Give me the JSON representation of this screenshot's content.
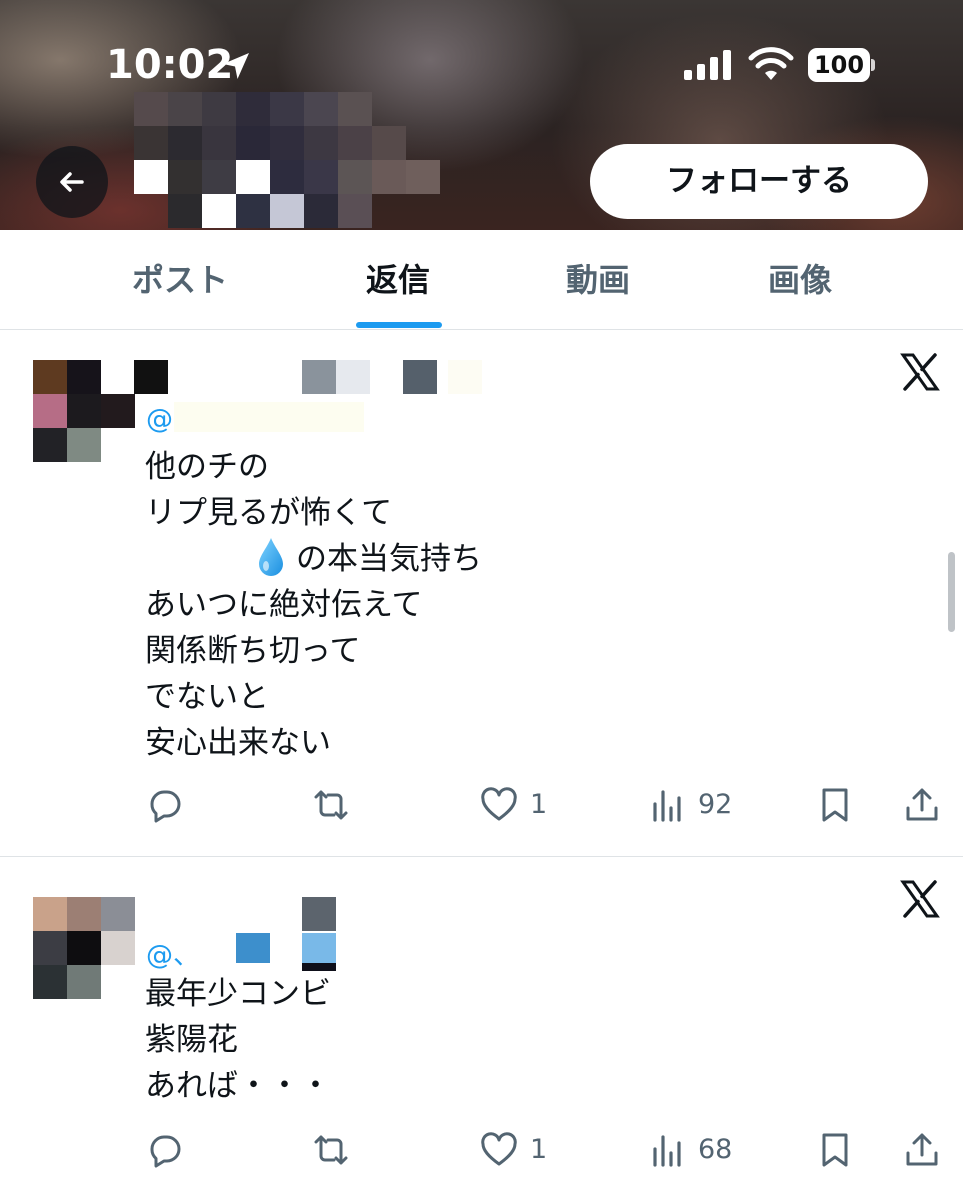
{
  "status_bar": {
    "time": "10:02",
    "battery": "100"
  },
  "header": {
    "follow_label": "フォローする"
  },
  "tabs": [
    {
      "label": "ポスト"
    },
    {
      "label": "返信"
    },
    {
      "label": "動画"
    },
    {
      "label": "画像"
    }
  ],
  "tweets": [
    {
      "handle": "@",
      "lines": [
        "他のチの",
        "リプ見るが怖くて",
        "の本当気持ち",
        "あいつに絶対伝えて",
        "関係断ち切って",
        "でないと",
        "安心出来ない"
      ],
      "likes": "1",
      "views": "92"
    },
    {
      "handle": "@、",
      "lines": [
        "最年少コンビ",
        "紫陽花",
        "あれば・・・"
      ],
      "likes": "1",
      "views": "68"
    }
  ],
  "icons": {
    "location": "location-arrow-icon",
    "signal": "cellular-signal-icon",
    "wifi": "wifi-icon",
    "back": "arrow-left-icon",
    "x_logo": "x-logo-icon",
    "reply": "reply-icon",
    "repost": "repost-icon",
    "like": "heart-icon",
    "views": "views-chart-icon",
    "bookmark": "bookmark-icon",
    "share": "share-icon",
    "drop": "droplet-emoji-icon"
  },
  "colors": {
    "accent": "#1d9bf0",
    "secondary_text": "#536471",
    "primary_text": "#0f1419"
  }
}
